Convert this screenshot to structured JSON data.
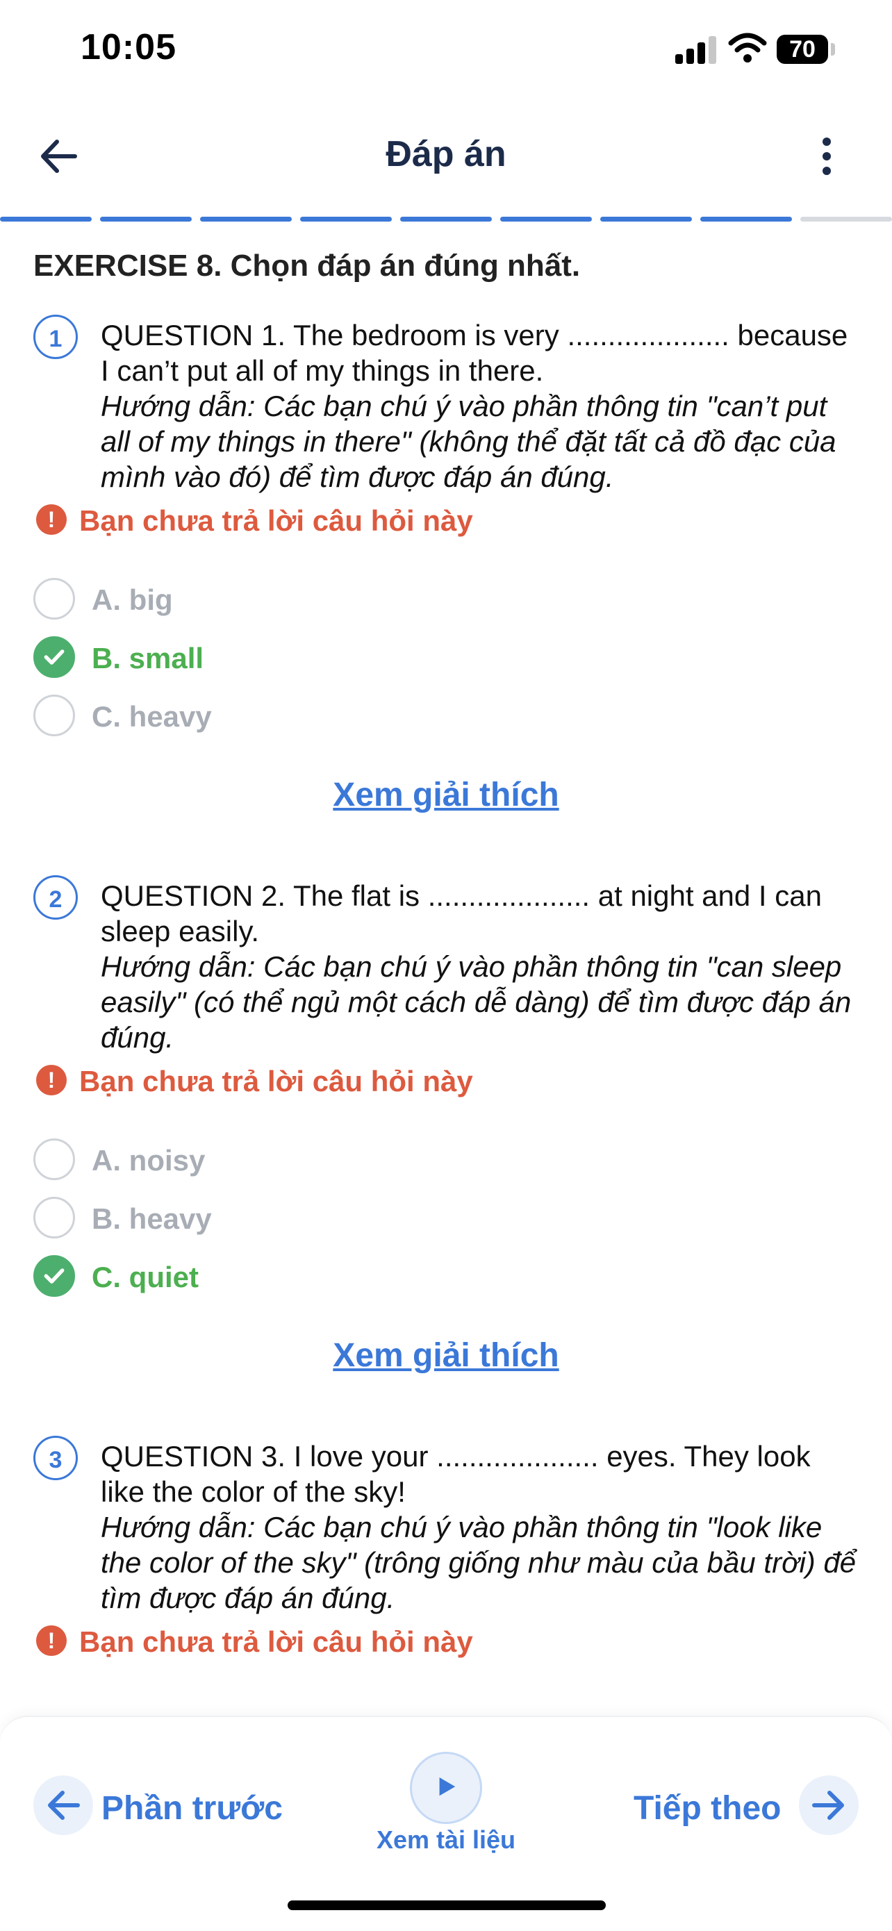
{
  "status_bar": {
    "time": "10:05",
    "battery": "70"
  },
  "header": {
    "title": "Đáp án",
    "progress": {
      "segments_total": 9,
      "segments_completed": 8
    }
  },
  "colors": {
    "accent": "#3b78d8",
    "correct": "#4caf6e",
    "warning": "#dd5a3f",
    "muted": "#a8adb5",
    "title": "#1c2b4a"
  },
  "exercise": {
    "title": "EXERCISE 8. Chọn đáp án đúng nhất."
  },
  "questions": [
    {
      "number": "1",
      "text": "QUESTION 1. The bedroom is very .................... because I can’t put all of my things in there.",
      "hint": "Hướng dẫn: Các bạn chú ý vào phần thông tin \"can’t put all of my things in there\" (không thể đặt tất cả đồ đạc của mình vào đó) để tìm được đáp án đúng.",
      "status": "Bạn chưa trả lời câu hỏi này",
      "options": [
        {
          "label": "A. big",
          "correct": false
        },
        {
          "label": "B. small",
          "correct": true
        },
        {
          "label": "C. heavy",
          "correct": false
        }
      ],
      "explain": "Xem giải thích"
    },
    {
      "number": "2",
      "text": "QUESTION 2. The flat is .................... at night and I can sleep easily.",
      "hint": "Hướng dẫn: Các bạn chú ý vào phần thông tin \"can sleep easily\" (có thể ngủ một cách dễ dàng) để tìm được đáp án đúng.",
      "status": "Bạn chưa trả lời câu hỏi này",
      "options": [
        {
          "label": "A. noisy",
          "correct": false
        },
        {
          "label": "B. heavy",
          "correct": false
        },
        {
          "label": "C. quiet",
          "correct": true
        }
      ],
      "explain": "Xem giải thích"
    },
    {
      "number": "3",
      "text": "QUESTION 3. I love your .................... eyes. They look like the color of the sky!",
      "hint": "Hướng dẫn: Các bạn chú ý vào phần thông tin \"look like the color of the sky\" (trông giống như màu của bầu trời) để tìm được đáp án đúng.",
      "status": "Bạn chưa trả lời câu hỏi này"
    }
  ],
  "bottom_bar": {
    "prev_label": "Phần trước",
    "doc_label": "Xem tài liệu",
    "next_label": "Tiếp theo"
  },
  "icons": {
    "back": "arrow-left-icon",
    "more": "more-vertical-icon",
    "warning": "exclamation-icon",
    "check": "check-icon",
    "play": "play-icon",
    "next": "arrow-right-icon"
  }
}
